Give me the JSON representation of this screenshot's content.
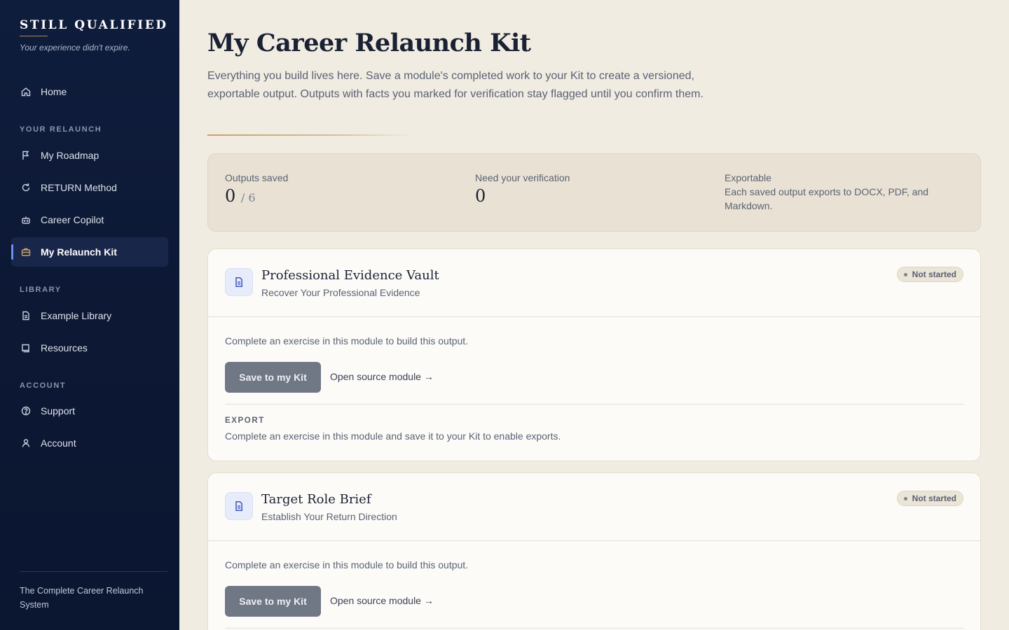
{
  "brand": {
    "name": "STILL QUALIFIED",
    "tagline": "Your experience didn't expire."
  },
  "sidebar": {
    "home": {
      "label": "Home",
      "icon": "home-icon"
    },
    "sections": {
      "relaunch": "YOUR RELAUNCH",
      "library": "LIBRARY",
      "account": "ACCOUNT"
    },
    "relaunch_items": [
      {
        "label": "My Roadmap",
        "icon": "flag-icon"
      },
      {
        "label": "RETURN Method",
        "icon": "refresh-icon"
      },
      {
        "label": "Career Copilot",
        "icon": "robot-icon"
      },
      {
        "label": "My Relaunch Kit",
        "icon": "briefcase-icon",
        "active": true
      }
    ],
    "library_items": [
      {
        "label": "Example Library",
        "icon": "document-icon"
      },
      {
        "label": "Resources",
        "icon": "book-icon"
      }
    ],
    "account_items": [
      {
        "label": "Support",
        "icon": "help-circle-icon"
      },
      {
        "label": "Account",
        "icon": "user-icon"
      }
    ],
    "footer": "The Complete Career Relaunch System"
  },
  "page": {
    "title": "My Career Relaunch Kit",
    "intro": "Everything you build lives here. Save a module's completed work to your Kit to create a versioned, exportable output. Outputs with facts you marked for verification stay flagged until you confirm them."
  },
  "stats": {
    "saved": {
      "label": "Outputs saved",
      "value": "0",
      "total": "/ 6"
    },
    "verify": {
      "label": "Need your verification",
      "value": "0"
    },
    "export": {
      "label": "Exportable",
      "text": "Each saved output exports to DOCX, PDF, and Markdown."
    }
  },
  "cards": [
    {
      "title": "Professional Evidence Vault",
      "subtitle": "Recover Your Professional Evidence",
      "status": "Not started",
      "hint": "Complete an exercise in this module to build this output.",
      "save_label": "Save to my Kit",
      "open_label": "Open source module →",
      "export_label": "EXPORT",
      "export_text": "Complete an exercise in this module and save it to your Kit to enable exports."
    },
    {
      "title": "Target Role Brief",
      "subtitle": "Establish Your Return Direction",
      "status": "Not started",
      "hint": "Complete an exercise in this module to build this output.",
      "save_label": "Save to my Kit",
      "open_label": "Open source module →"
    }
  ],
  "colors": {
    "sidebar_bg": "#0f1d3d",
    "accent": "#6f8ff0",
    "gold": "#c9a06b",
    "page_bg": "#f1ece2"
  }
}
